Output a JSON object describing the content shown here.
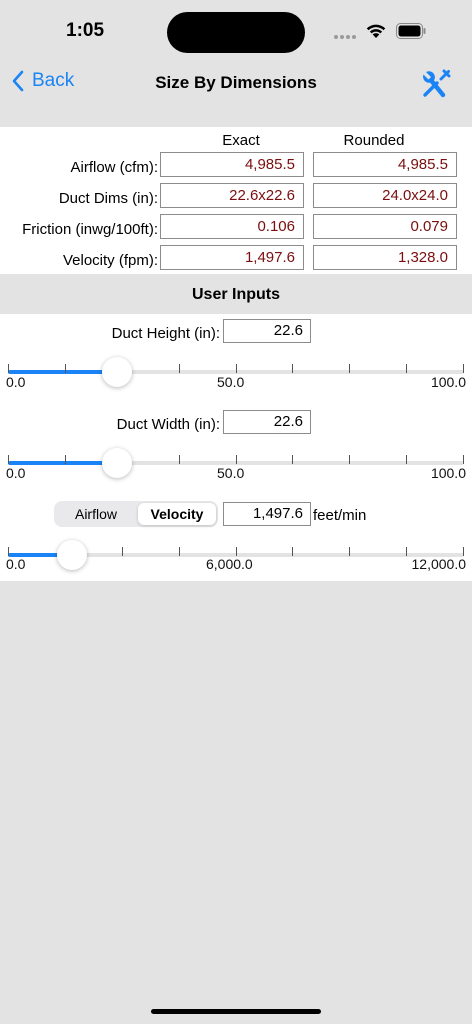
{
  "status_bar": {
    "time": "1:05"
  },
  "nav": {
    "back_label": "Back",
    "title": "Size By Dimensions"
  },
  "results": {
    "columns": [
      "Exact",
      "Rounded"
    ],
    "rows": [
      {
        "label": "Airflow (cfm):",
        "exact": "4,985.5",
        "rounded": "4,985.5"
      },
      {
        "label": "Duct Dims (in):",
        "exact": "22.6x22.6",
        "rounded": "24.0x24.0"
      },
      {
        "label": "Friction (inwg/100ft):",
        "exact": "0.106",
        "rounded": "0.079"
      },
      {
        "label": "Velocity (fpm):",
        "exact": "1,497.6",
        "rounded": "1,328.0"
      }
    ]
  },
  "inputs": {
    "section_title": "User Inputs",
    "duct_height": {
      "label": "Duct Height (in):",
      "value": "22.6",
      "slider": {
        "min_label": "0.0",
        "mid_label": "50.0",
        "max_label": "100.0",
        "fraction": 0.24
      }
    },
    "duct_width": {
      "label": "Duct Width (in):",
      "value": "22.6",
      "slider": {
        "min_label": "0.0",
        "mid_label": "50.0",
        "max_label": "100.0",
        "fraction": 0.24
      }
    },
    "mode": {
      "options": [
        "Airflow",
        "Velocity"
      ],
      "selected": "Velocity",
      "value": "1,497.6",
      "unit": "feet/min",
      "slider": {
        "min_label": "0.0",
        "mid_label": "6,000.0",
        "max_label": "12,000.0",
        "fraction": 0.14
      }
    }
  },
  "colors": {
    "accent": "#1a84f6",
    "value_text": "#7a0e0e",
    "background": "#e3e3e3"
  }
}
